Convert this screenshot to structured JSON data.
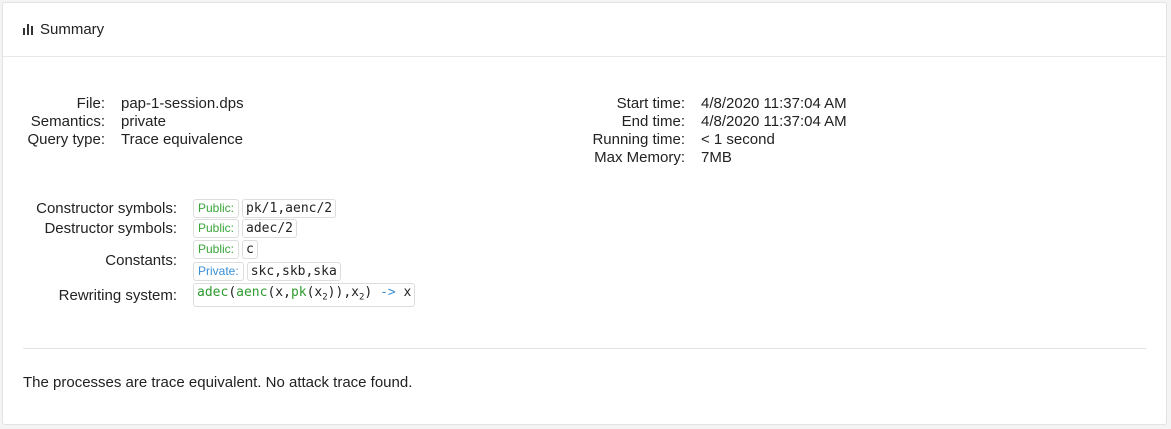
{
  "header": {
    "title": "Summary",
    "icon": "bar-chart-icon"
  },
  "left_info": [
    {
      "key": "File:",
      "value": "pap-1-session.dps"
    },
    {
      "key": "Semantics:",
      "value": "private"
    },
    {
      "key": "Query type:",
      "value": "Trace equivalence"
    }
  ],
  "right_info": [
    {
      "key": "Start time:",
      "value": "4/8/2020 11:37:04 AM"
    },
    {
      "key": "End time:",
      "value": "4/8/2020 11:37:04 AM"
    },
    {
      "key": "Running time:",
      "value": "< 1 second"
    },
    {
      "key": "Max Memory:",
      "value": "7MB"
    }
  ],
  "symbols": {
    "constructor_label": "Constructor symbols:",
    "destructor_label": "Destructor symbols:",
    "constants_label": "Constants:",
    "rewriting_label": "Rewriting system:",
    "public_badge": "Public:",
    "private_badge": "Private:",
    "constructor_public": "pk/1,aenc/2",
    "destructor_public": "adec/2",
    "constants_public": "c",
    "constants_private": "skc,skb,ska",
    "rewrite": {
      "adec": "adec",
      "aenc": "aenc",
      "pk": "pk",
      "x": "x",
      "x2": "x",
      "sub2": "2",
      "arrow": "->",
      "rhs": "x"
    }
  },
  "result_text": "The processes are trace equivalent. No attack trace found."
}
